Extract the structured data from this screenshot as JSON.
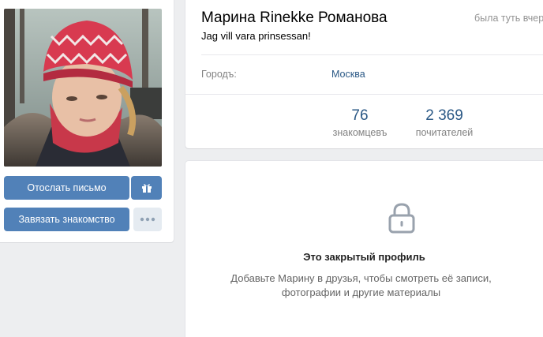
{
  "profile": {
    "name": "Марина Rinekke Романова",
    "online_status": "была туть вчер",
    "status_text": "Jag vill vara prinsessan!",
    "avatar_alt": "avatar"
  },
  "actions": {
    "send_message": "Отослать письмо",
    "gift_icon": "gift-icon",
    "add_friend": "Завязать знакомство",
    "more_icon": "more-dots-icon"
  },
  "info": {
    "city_label": "Городъ:",
    "city_value": "Москва"
  },
  "counters": [
    {
      "value": "76",
      "label": "знакомцевъ"
    },
    {
      "value": "2 369",
      "label": "почитателей"
    }
  ],
  "closed_profile": {
    "icon": "lock-icon",
    "title": "Это закрытый профиль",
    "description_line1": "Добавьте Марину в друзья, чтобы смотреть её записи,",
    "description_line2": "фотографии и другие материалы"
  },
  "colors": {
    "accent": "#5181b8",
    "link": "#2a5885",
    "background": "#edeef0"
  }
}
